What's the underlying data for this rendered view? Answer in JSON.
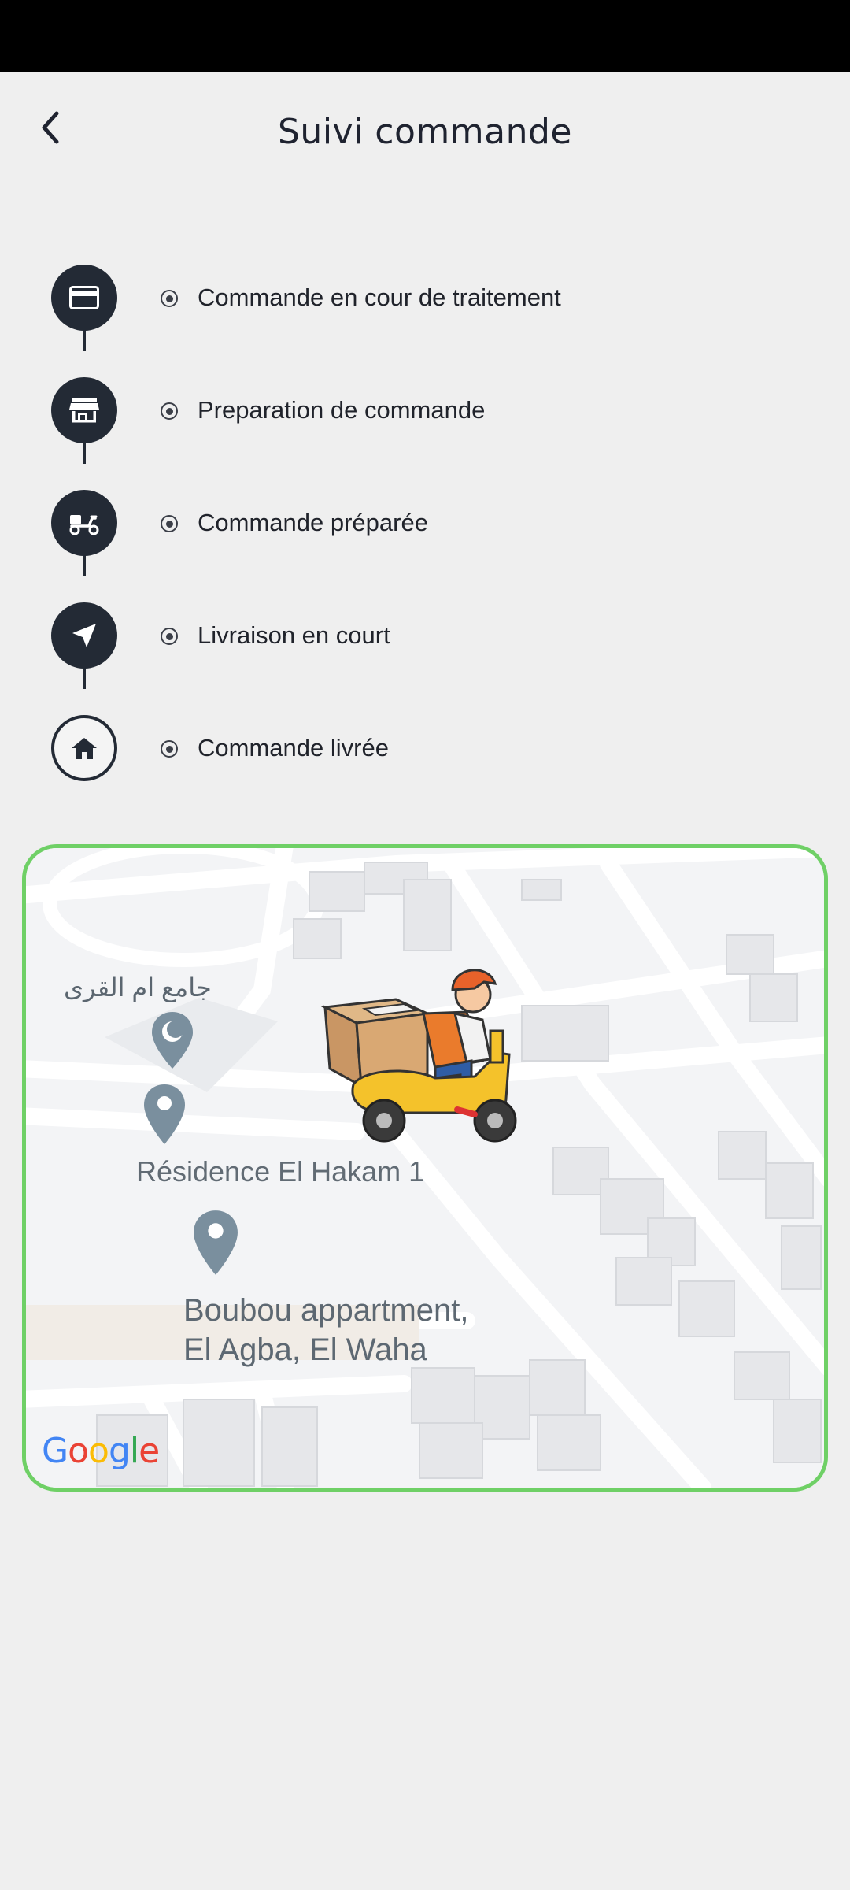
{
  "header": {
    "title": "Suivi commande",
    "back_icon": "chevron-left-icon"
  },
  "steps": [
    {
      "label": "Commande en cour de traitement",
      "icon": "credit-card-icon",
      "state": "done"
    },
    {
      "label": "Preparation de commande",
      "icon": "store-icon",
      "state": "done"
    },
    {
      "label": "Commande préparée",
      "icon": "scooter-icon",
      "state": "done"
    },
    {
      "label": "Livraison en court",
      "icon": "navigation-arrow-icon",
      "state": "done"
    },
    {
      "label": "Commande livrée",
      "icon": "home-icon",
      "state": "pending"
    }
  ],
  "map": {
    "labels": {
      "mosque": "جامع ام القرى",
      "residence": "Résidence El Hakam 1",
      "boubou_line1": "Boubou appartment,",
      "boubou_line2": "El Agba, El Waha"
    },
    "attribution": "Google"
  },
  "colors": {
    "accent_dark": "#232a35",
    "map_border": "#6fd066",
    "background": "#efefef"
  }
}
